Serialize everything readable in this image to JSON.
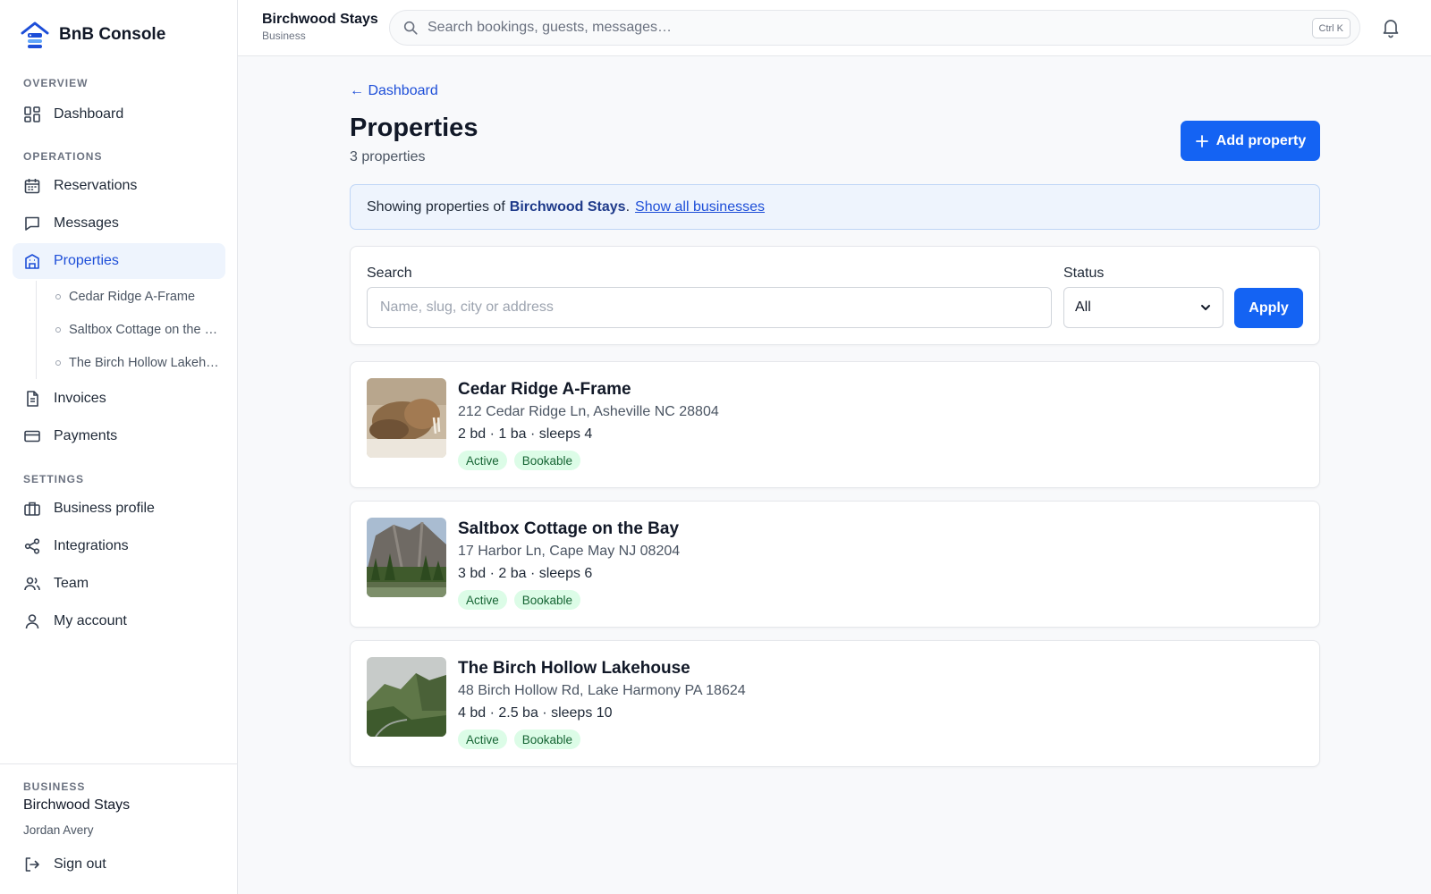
{
  "brand": {
    "name": "BnB Console"
  },
  "sidebar": {
    "sections": {
      "overview": "OVERVIEW",
      "operations": "OPERATIONS",
      "settings": "SETTINGS"
    },
    "items": {
      "dashboard": "Dashboard",
      "reservations": "Reservations",
      "messages": "Messages",
      "properties": "Properties",
      "invoices": "Invoices",
      "payments": "Payments",
      "business_profile": "Business profile",
      "integrations": "Integrations",
      "team": "Team",
      "my_account": "My account"
    },
    "sub_items": [
      {
        "label": "Cedar Ridge A-Frame"
      },
      {
        "label": "Saltbox Cottage on the Bay"
      },
      {
        "label": "The Birch Hollow Lakehouse"
      }
    ],
    "footer": {
      "label": "BUSINESS",
      "business_name": "Birchwood Stays",
      "user": "Jordan Avery",
      "sign_out": "Sign out"
    }
  },
  "topbar": {
    "title": "Birchwood Stays",
    "subtitle": "Business",
    "search_placeholder": "Search bookings, guests, messages…",
    "shortcut": "Ctrl K"
  },
  "main": {
    "back_link": "← Dashboard",
    "title": "Properties",
    "count": "3 properties",
    "add_button": "Add property",
    "banner": {
      "prefix": "Showing properties of",
      "business": "Birchwood Stays",
      "suffix": ".",
      "link": "Show all businesses"
    },
    "filters": {
      "search_label": "Search",
      "search_placeholder": "Name, slug, city or address",
      "status_label": "Status",
      "status_value": "All",
      "apply": "Apply"
    },
    "properties": [
      {
        "name": "Cedar Ridge A-Frame",
        "address": "212 Cedar Ridge Ln, Asheville NC 28804",
        "meta": "2 bd · 1 ba · sleeps 4",
        "badges": [
          "Active",
          "Bookable"
        ]
      },
      {
        "name": "Saltbox Cottage on the Bay",
        "address": "17 Harbor Ln, Cape May NJ 08204",
        "meta": "3 bd · 2 ba · sleeps 6",
        "badges": [
          "Active",
          "Bookable"
        ]
      },
      {
        "name": "The Birch Hollow Lakehouse",
        "address": "48 Birch Hollow Rd, Lake Harmony PA 18624",
        "meta": "4 bd · 2.5 ba · sleeps 10",
        "badges": [
          "Active",
          "Bookable"
        ]
      }
    ]
  },
  "colors": {
    "accent": "#1463f3",
    "active_nav_bg": "#eef4fd",
    "badge_bg": "#dcfce7",
    "badge_text": "#166534"
  }
}
